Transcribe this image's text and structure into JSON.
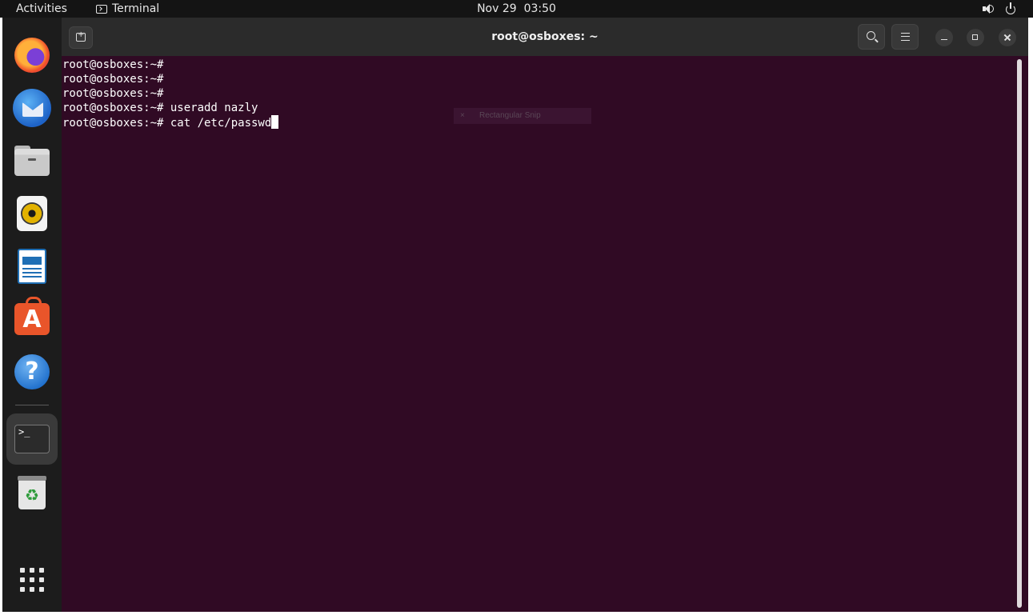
{
  "topbar": {
    "activities": "Activities",
    "app_name": "Terminal",
    "clock": "Nov 29  03:50",
    "icons": [
      "speaker-icon",
      "power-icon"
    ]
  },
  "dock": {
    "items": [
      {
        "name": "Firefox",
        "icon": "firefox-icon"
      },
      {
        "name": "Thunderbird",
        "icon": "thunderbird-icon"
      },
      {
        "name": "Files",
        "icon": "files-icon"
      },
      {
        "name": "Rhythmbox",
        "icon": "rhythmbox-icon"
      },
      {
        "name": "LibreOffice Writer",
        "icon": "writer-icon"
      },
      {
        "name": "Ubuntu Software",
        "icon": "software-icon"
      },
      {
        "name": "Help",
        "icon": "help-icon"
      },
      {
        "name": "Terminal",
        "icon": "terminal-icon",
        "active": true
      },
      {
        "name": "Trash",
        "icon": "trash-icon"
      },
      {
        "name": "Show Applications",
        "icon": "apps-grid-icon"
      }
    ],
    "terminal_glyph": ">_",
    "software_glyph": "A",
    "help_glyph": "?",
    "trash_glyph": "♻"
  },
  "window": {
    "title": "root@osboxes: ~",
    "terminal": {
      "lines": [
        "root@osboxes:~#",
        "root@osboxes:~#",
        "root@osboxes:~#",
        "root@osboxes:~# useradd nazly",
        "root@osboxes:~# cat /etc/passwd"
      ],
      "background": "#300a24",
      "foreground": "#ffffff"
    },
    "snip_overlay": {
      "close": "×",
      "label": "Rectangular Snip"
    }
  },
  "colors": {
    "accent": "#e95420",
    "topbar": "#141414",
    "dock": "#1c1c1c",
    "headerbar": "#2b2b2b"
  }
}
